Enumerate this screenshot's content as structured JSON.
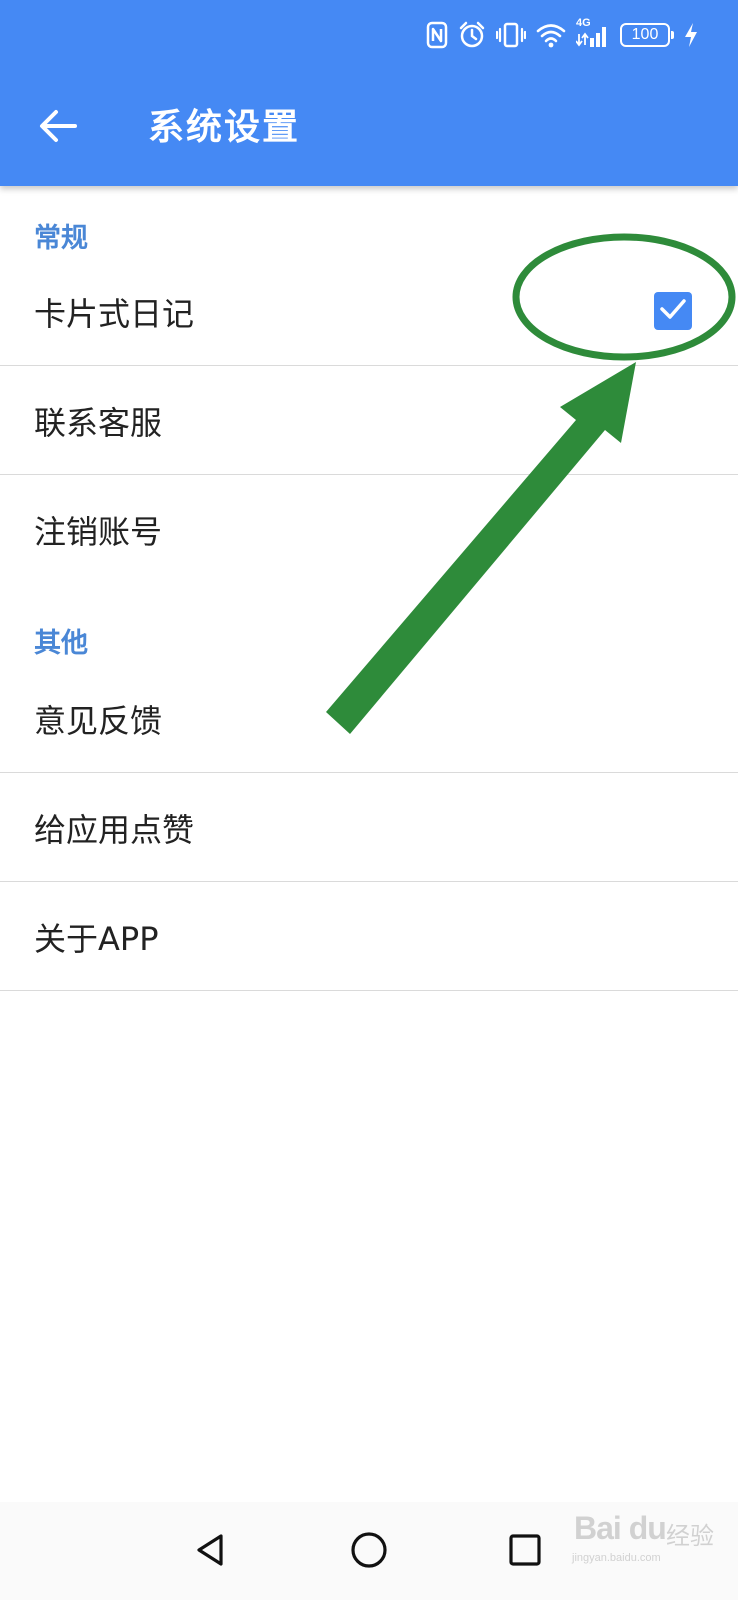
{
  "status_bar": {
    "icons": [
      "nfc-icon",
      "alarm-icon",
      "vibrate-icon",
      "wifi-icon",
      "cellular-signal-icon",
      "battery-icon",
      "charging-icon"
    ],
    "network_type": "4G",
    "battery_level": "100"
  },
  "app_bar": {
    "back_icon": "arrow-left-icon",
    "title": "系统设置"
  },
  "settings": {
    "general_header": "常规",
    "card_diary": {
      "label": "卡片式日记",
      "checked": true
    },
    "contact_support": "联系客服",
    "delete_account": "注销账号",
    "other_header": "其他",
    "feedback": "意见反馈",
    "rate_app": "给应用点赞",
    "about_app": "关于APP"
  },
  "nav_bar": {
    "icons": [
      "back-triangle-icon",
      "home-circle-icon",
      "recents-square-icon"
    ]
  },
  "watermark": {
    "brand": "Bai du",
    "cn": "经验",
    "url": "jingyan.baidu.com"
  },
  "colors": {
    "app_bar": "#4589F4",
    "section_header": "#4A87D6",
    "checkbox": "#4589F4",
    "annotation": "#2E8B3A"
  }
}
